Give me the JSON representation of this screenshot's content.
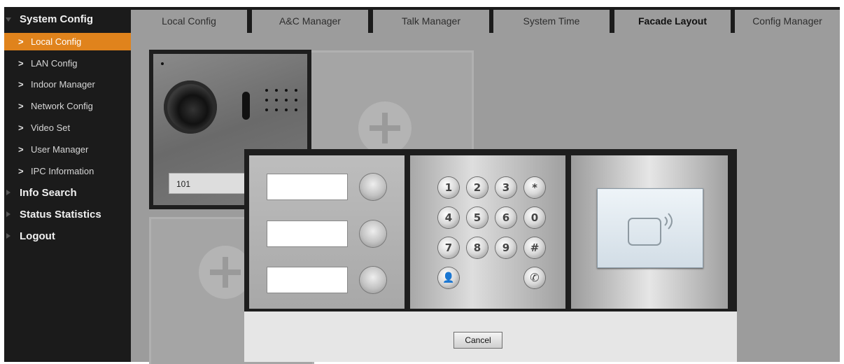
{
  "sidebar": {
    "sections": [
      {
        "label": "System Config",
        "expanded": true
      },
      {
        "label": "Info Search",
        "expanded": false
      },
      {
        "label": "Status Statistics",
        "expanded": false
      },
      {
        "label": "Logout",
        "expanded": false
      }
    ],
    "items": [
      {
        "label": "Local Config",
        "active": true
      },
      {
        "label": "LAN Config"
      },
      {
        "label": "Indoor Manager"
      },
      {
        "label": "Network Config"
      },
      {
        "label": "Video Set"
      },
      {
        "label": "User Manager"
      },
      {
        "label": "IPC Information"
      }
    ],
    "chevron": ">"
  },
  "tabs": [
    {
      "label": "Local Config"
    },
    {
      "label": "A&C Manager"
    },
    {
      "label": "Talk Manager"
    },
    {
      "label": "System Time"
    },
    {
      "label": "Facade Layout",
      "active": true
    },
    {
      "label": "Config Manager"
    }
  ],
  "facade": {
    "room_number": "101"
  },
  "dialog": {
    "keypad_keys": [
      "1",
      "2",
      "3",
      "*",
      "4",
      "5",
      "6",
      "0",
      "7",
      "8",
      "9",
      "#",
      "👤",
      "✆"
    ],
    "cancel_label": "Cancel"
  },
  "colors": {
    "accent": "#e0831c",
    "sidebar_bg": "#1b1b1b",
    "content_bg": "#9c9c9c"
  },
  "icons": [
    "camera-icon",
    "speaker-icon",
    "plus-icon",
    "person-icon",
    "phone-icon",
    "card-reader-icon"
  ]
}
